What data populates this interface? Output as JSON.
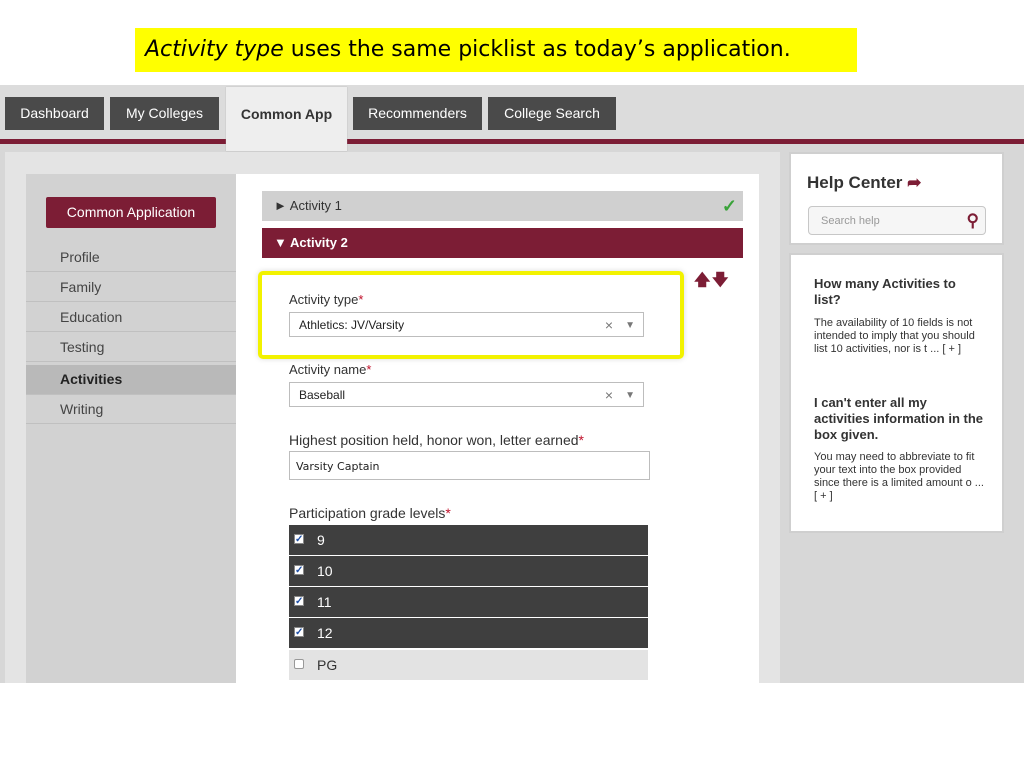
{
  "caption": {
    "italic": "Activity type",
    "rest": " uses  the same picklist as today’s application."
  },
  "nav": {
    "tabs": [
      "Dashboard",
      "My Colleges",
      "Common App",
      "Recommenders",
      "College Search"
    ],
    "active": "Common App"
  },
  "sidebar": {
    "app_button": "Common Application",
    "items": [
      "Profile",
      "Family",
      "Education",
      "Testing",
      "Activities",
      "Writing"
    ],
    "active": "Activities"
  },
  "form": {
    "activity1": "Activity 1",
    "activity2": "Activity 2",
    "expand_glyph_collapsed": "►",
    "expand_glyph_open": "▼",
    "check_glyph": "✓",
    "move_up_glyph": "🡅",
    "move_down_glyph": "🡇",
    "required_mark": "*",
    "clear_glyph": "×",
    "dropdown_glyph": "▼",
    "activity_type": {
      "label": "Activity type",
      "value": "Athletics: JV/Varsity"
    },
    "activity_name": {
      "label": "Activity name",
      "value": "Baseball"
    },
    "position": {
      "label": "Highest position held, honor won, letter earned",
      "value": "Varsity Captain"
    },
    "grades": {
      "label": "Participation grade levels",
      "items": [
        {
          "label": "9",
          "checked": true
        },
        {
          "label": "10",
          "checked": true
        },
        {
          "label": "11",
          "checked": true
        },
        {
          "label": "12",
          "checked": true
        },
        {
          "label": "PG",
          "checked": false
        }
      ],
      "check_glyph": "✓"
    }
  },
  "help": {
    "title": "Help Center",
    "title_arrow": "➦",
    "search_placeholder": "Search help",
    "search_icon": "⚲",
    "q1_title": "How many Activities to list?",
    "q1_body": "The availability of 10 fields is not intended to imply that you should list 10 activities, nor is t ... [ + ]",
    "q2_title": "I can't enter all my activities information in the box given.",
    "q2_body": "You may need to abbreviate to fit your text into the box provided since there is a limited amount o ... [ + ]"
  },
  "colors": {
    "accent": "#7c1d35",
    "highlight": "#ffff00",
    "check_green": "#3aa33a",
    "grade_row": "#3f3f3f"
  }
}
